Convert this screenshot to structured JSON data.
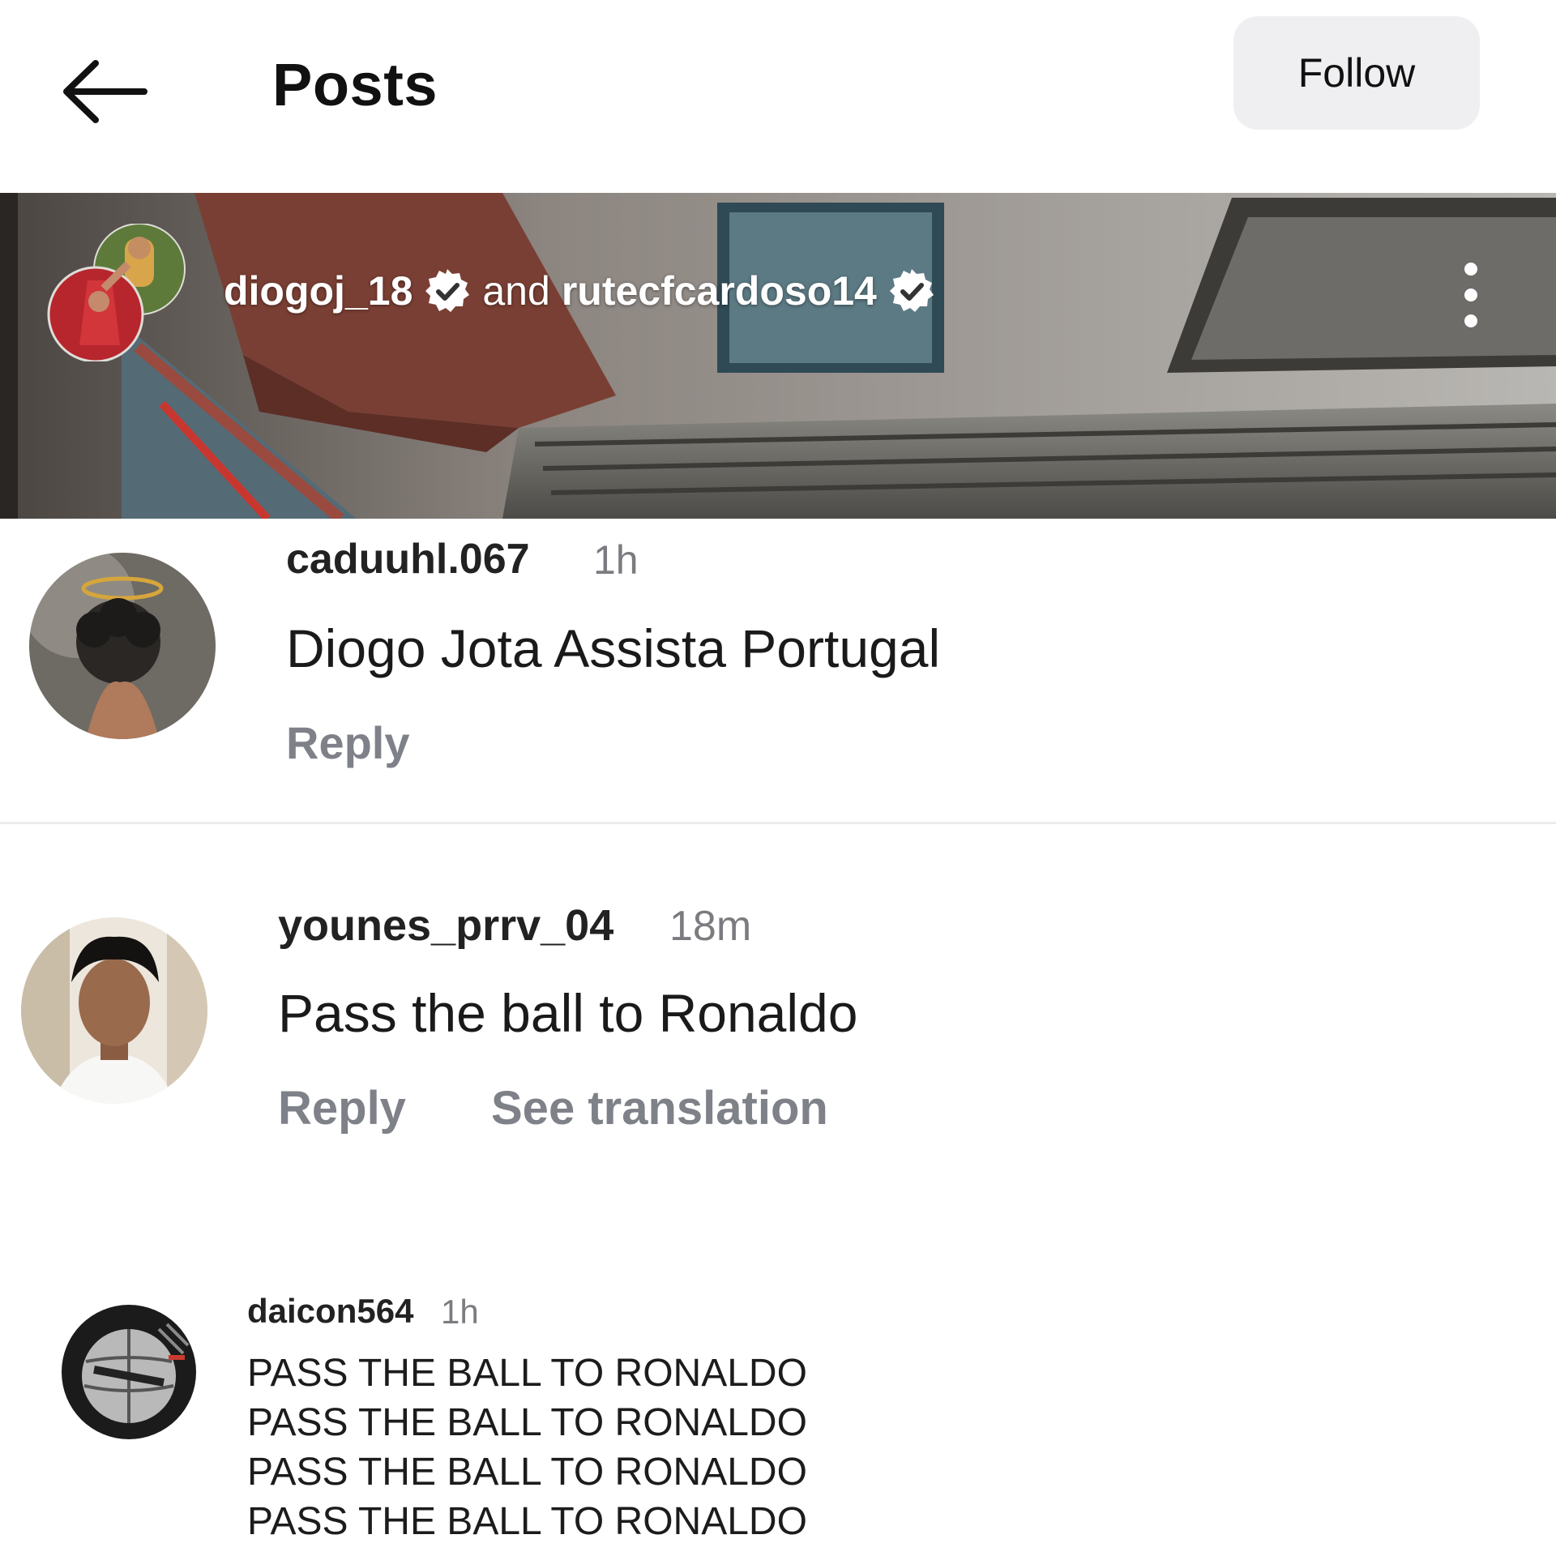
{
  "header": {
    "title": "Posts",
    "follow_label": "Follow",
    "icons": {
      "back": "arrow-left-icon"
    }
  },
  "post": {
    "author": "diogoj_18",
    "connector": "and",
    "coauthor": "rutecfcardoso14",
    "icons": {
      "verified": "verified-badge-icon",
      "more": "more-vertical-icon"
    }
  },
  "comments": [
    {
      "username": "caduuhl.067",
      "time": "1h",
      "text": "Diogo Jota Assista Portugal",
      "reply_label": "Reply"
    },
    {
      "username": "younes_prrv_04",
      "time": "18m",
      "text": "Pass the ball to Ronaldo",
      "reply_label": "Reply",
      "translate_label": "See translation"
    },
    {
      "username": "daicon564",
      "time": "1h",
      "lines": [
        "PASS THE BALL TO RONALDO",
        "PASS THE BALL TO RONALDO",
        "PASS THE BALL TO RONALDO",
        "PASS THE BALL TO RONALDO"
      ]
    }
  ],
  "colors": {
    "follow_bg": "#efeff1",
    "secondary_text": "#7e8188",
    "divider": "#ececee"
  }
}
